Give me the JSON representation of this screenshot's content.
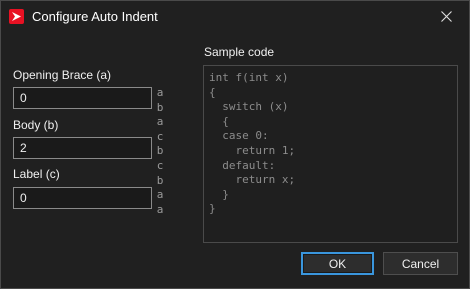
{
  "window": {
    "title": "Configure Auto Indent"
  },
  "fields": [
    {
      "label": "Opening Brace (a)",
      "value": "0"
    },
    {
      "label": "Body (b)",
      "value": "2"
    },
    {
      "label": "Label (c)",
      "value": "0"
    }
  ],
  "line_letters": [
    "a",
    "b",
    "a",
    "c",
    "b",
    "c",
    "b",
    "a",
    "a"
  ],
  "sample": {
    "label": "Sample code",
    "lines": [
      "int f(int x)",
      "{",
      "  switch (x)",
      "  {",
      "  case 0:",
      "    return 1;",
      "  default:",
      "    return x;",
      "  }",
      "}"
    ]
  },
  "buttons": {
    "ok": "OK",
    "cancel": "Cancel"
  },
  "colors": {
    "accent": "#3a96dd",
    "app_icon": "#e81123"
  }
}
